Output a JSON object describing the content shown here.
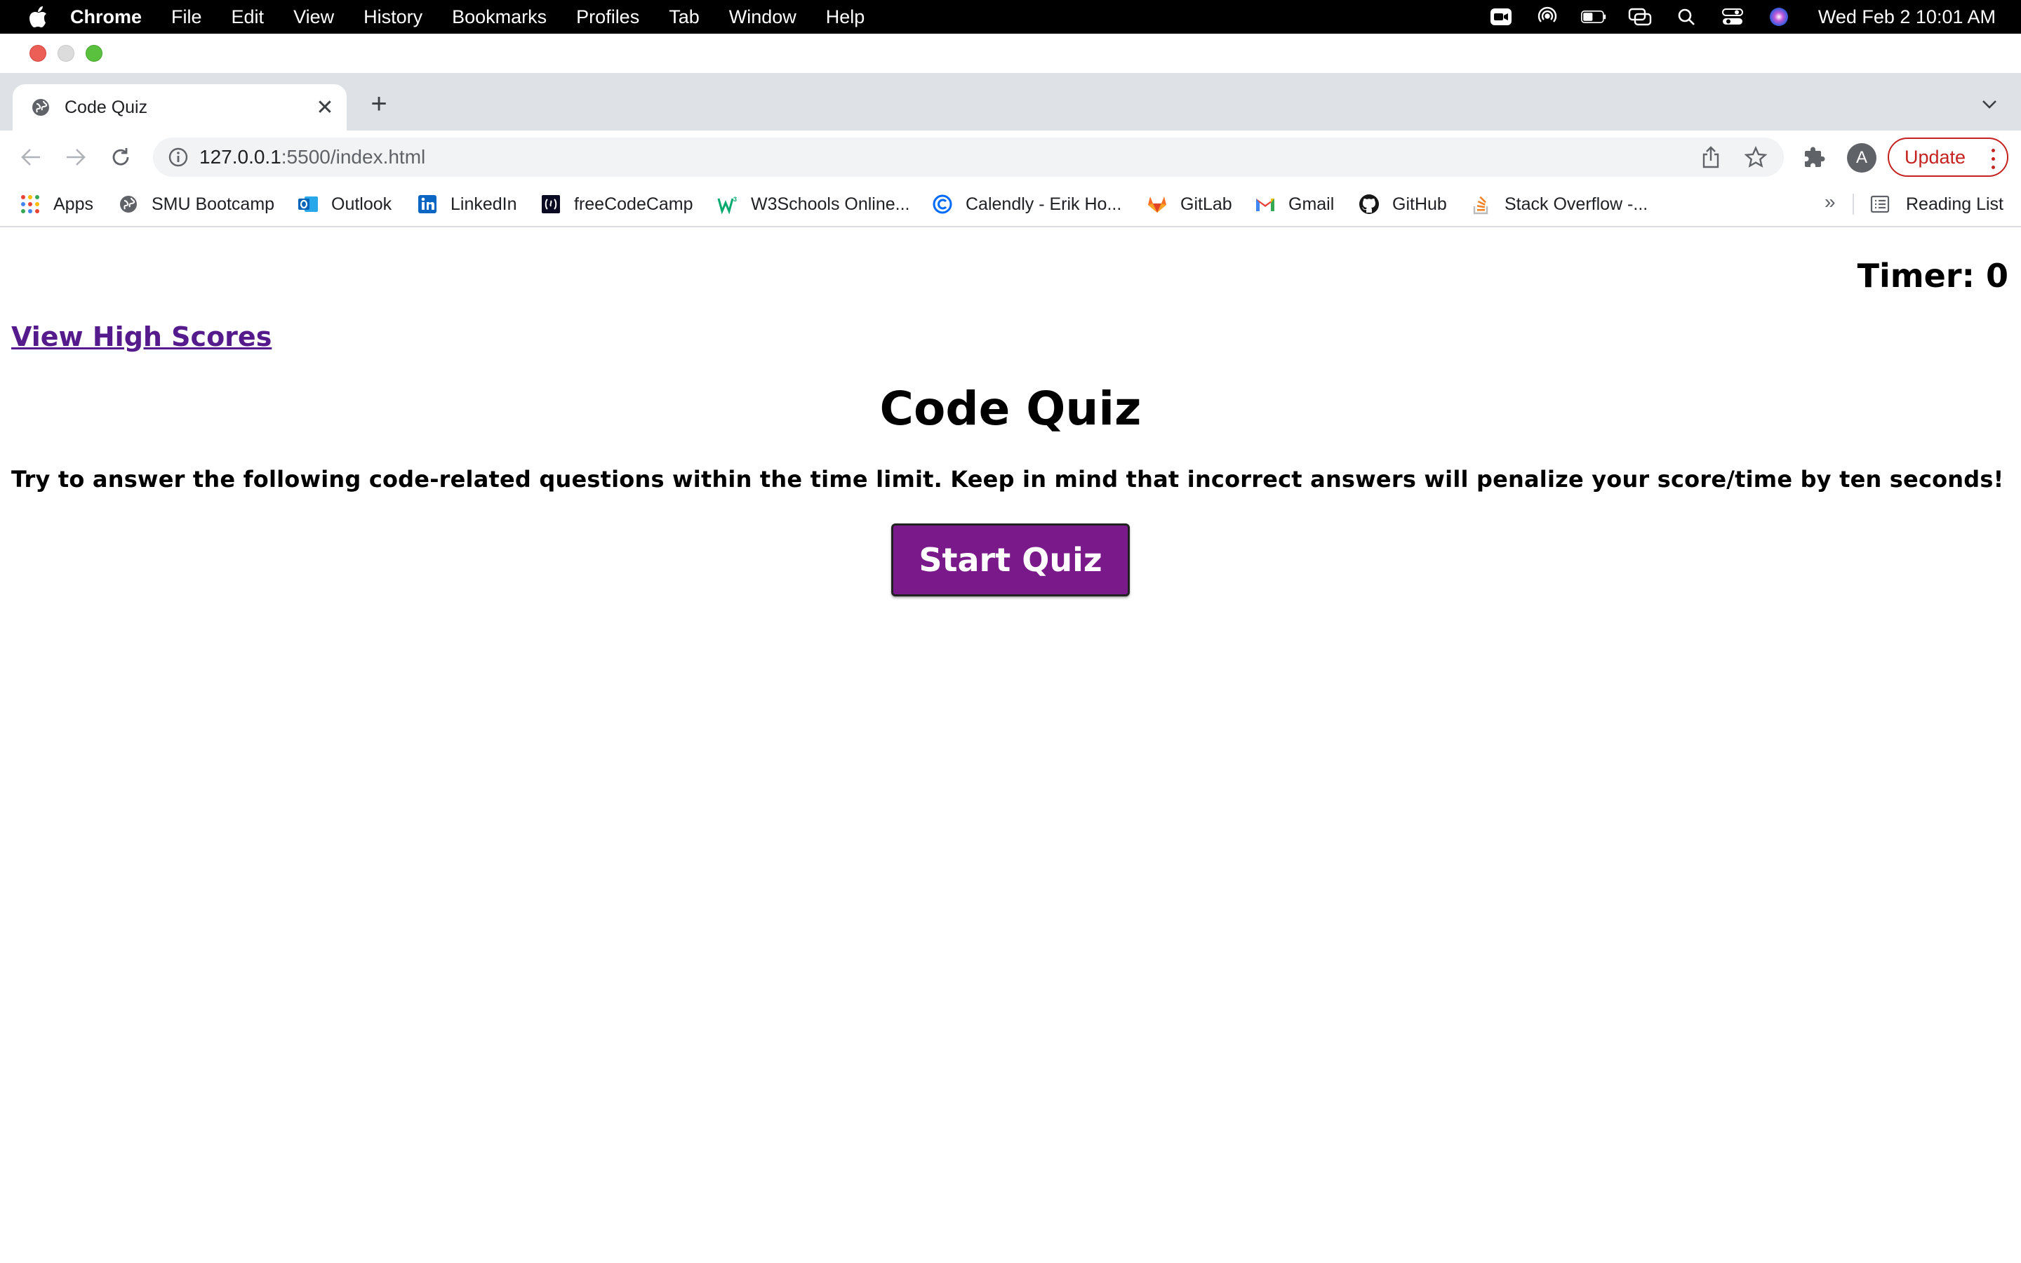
{
  "menubar": {
    "app_name": "Chrome",
    "items": [
      "File",
      "Edit",
      "View",
      "History",
      "Bookmarks",
      "Profiles",
      "Tab",
      "Window",
      "Help"
    ],
    "clock": "Wed Feb 2  10:01 AM"
  },
  "tab": {
    "title": "Code Quiz",
    "close": "✕",
    "new_tab": "+"
  },
  "omnibox": {
    "host": "127.0.0.1",
    "path": ":5500/index.html"
  },
  "toolbar": {
    "avatar_letter": "A",
    "update_label": "Update"
  },
  "bookmarks": {
    "items": [
      {
        "label": "Apps",
        "icon": "apps-grid-icon"
      },
      {
        "label": "SMU Bootcamp",
        "icon": "globe-icon"
      },
      {
        "label": "Outlook",
        "icon": "outlook-icon"
      },
      {
        "label": "LinkedIn",
        "icon": "linkedin-icon"
      },
      {
        "label": "freeCodeCamp",
        "icon": "freecodecamp-icon"
      },
      {
        "label": "W3Schools Online...",
        "icon": "w3schools-icon"
      },
      {
        "label": "Calendly - Erik Ho...",
        "icon": "calendly-icon"
      },
      {
        "label": "GitLab",
        "icon": "gitlab-icon"
      },
      {
        "label": "Gmail",
        "icon": "gmail-icon"
      },
      {
        "label": "GitHub",
        "icon": "github-icon"
      },
      {
        "label": "Stack Overflow -...",
        "icon": "stackoverflow-icon"
      }
    ],
    "more": "»",
    "reading_list": "Reading List"
  },
  "page": {
    "timer": "Timer: 0",
    "high_scores_link": "View High Scores",
    "title": "Code Quiz",
    "description": "Try to answer the following code-related questions within the time limit. Keep in mind that incorrect answers will penalize your score/time by ten seconds!",
    "start_button": "Start Quiz"
  },
  "colors": {
    "start_button_bg": "#7a1a8a",
    "link_visited": "#551a8b",
    "update_red": "#c5221f"
  }
}
